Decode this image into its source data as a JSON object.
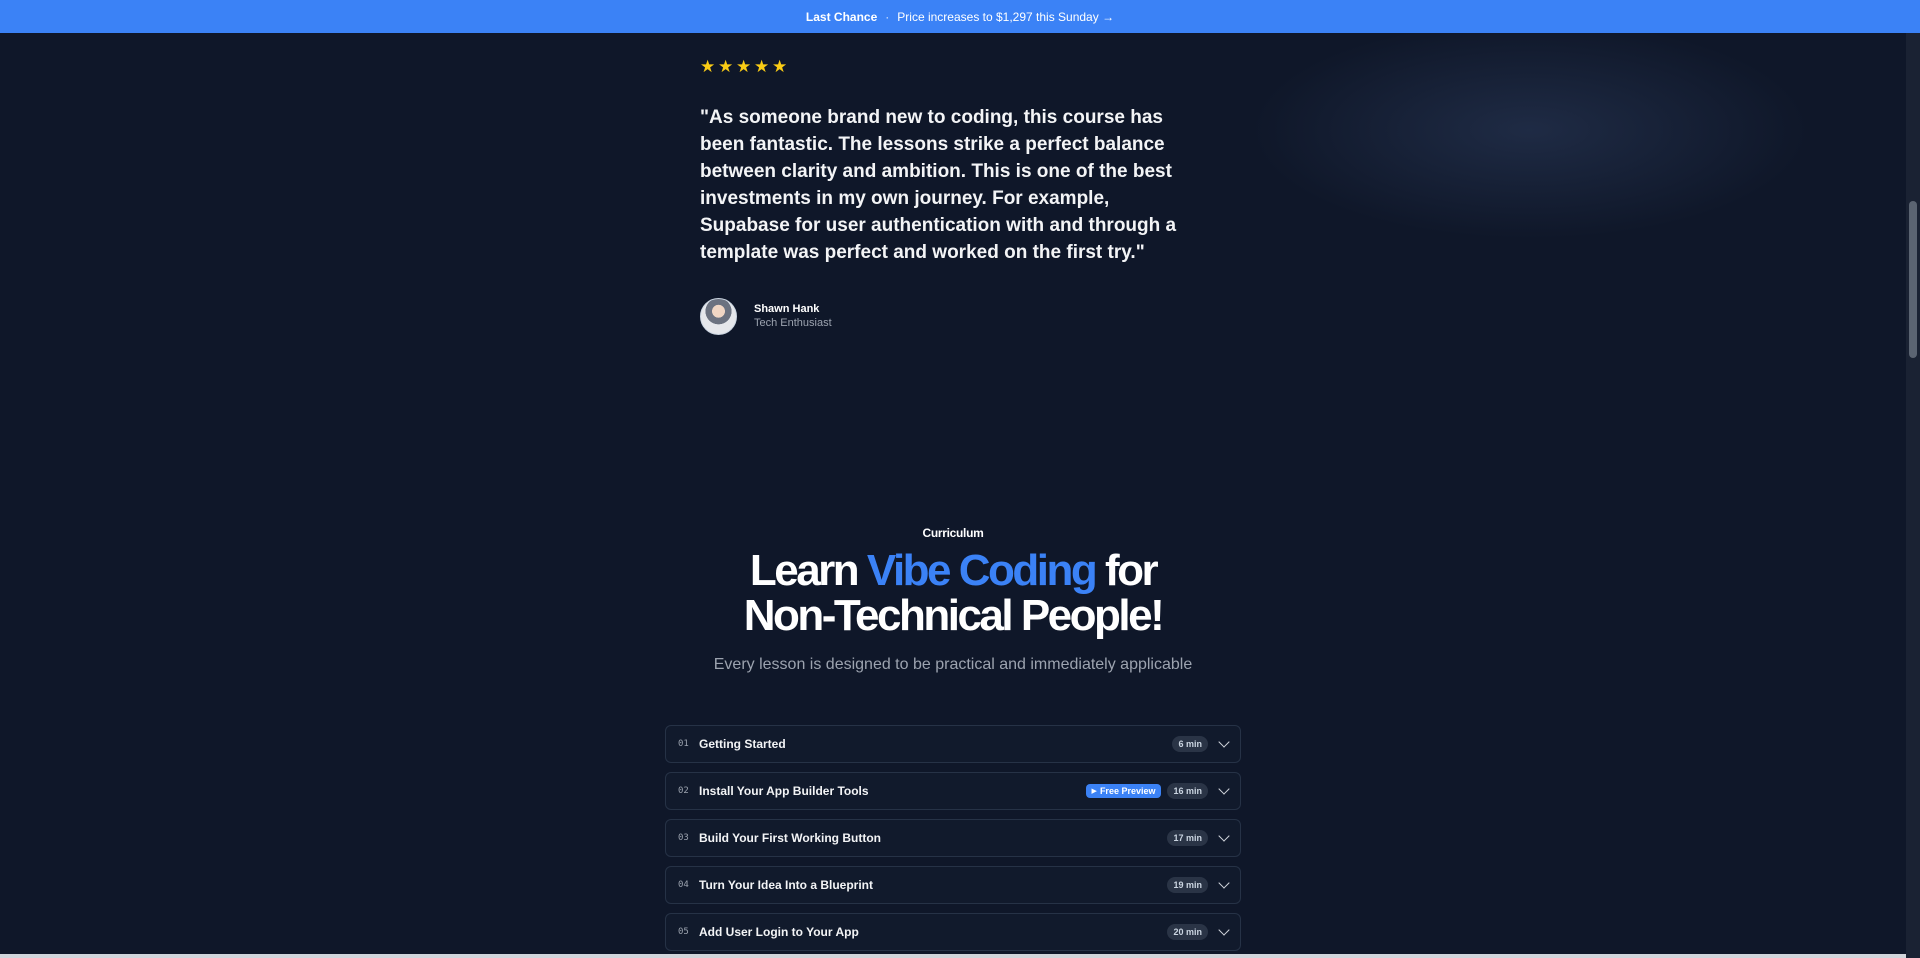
{
  "announcement": {
    "strong": "Last Chance",
    "separator": "·",
    "text": "Price increases to $1,297 this Sunday →"
  },
  "testimonial": {
    "rating": 5,
    "quote": "\"As someone brand new to coding, this course has been fantastic. The lessons strike a perfect balance between clarity and ambition. This is one of the best investments in my own journey. For example, Supabase for user authentication with and through a template was perfect and worked on the first try.\"",
    "author_name": "Shawn Hank",
    "author_role": "Tech Enthusiast"
  },
  "curriculum": {
    "label": "Curriculum",
    "headline_part1": "Learn",
    "headline_accent": "Vibe Coding",
    "headline_part2": "for",
    "headline_line2": "Non-Technical People!",
    "subhead": "Every lesson is designed to be practical and immediately applicable",
    "lessons": [
      {
        "num": "01",
        "title": "Getting Started",
        "duration": "6 min",
        "preview": ""
      },
      {
        "num": "02",
        "title": "Install Your App Builder Tools",
        "duration": "16 min",
        "preview": "Free Preview"
      },
      {
        "num": "03",
        "title": "Build Your First Working Button",
        "duration": "17 min",
        "preview": ""
      },
      {
        "num": "04",
        "title": "Turn Your Idea Into a Blueprint",
        "duration": "19 min",
        "preview": ""
      },
      {
        "num": "05",
        "title": "Add User Login to Your App",
        "duration": "20 min",
        "preview": ""
      }
    ]
  },
  "colors": {
    "background": "#0f1729",
    "accent": "#3b82f6",
    "star": "#facc15"
  }
}
